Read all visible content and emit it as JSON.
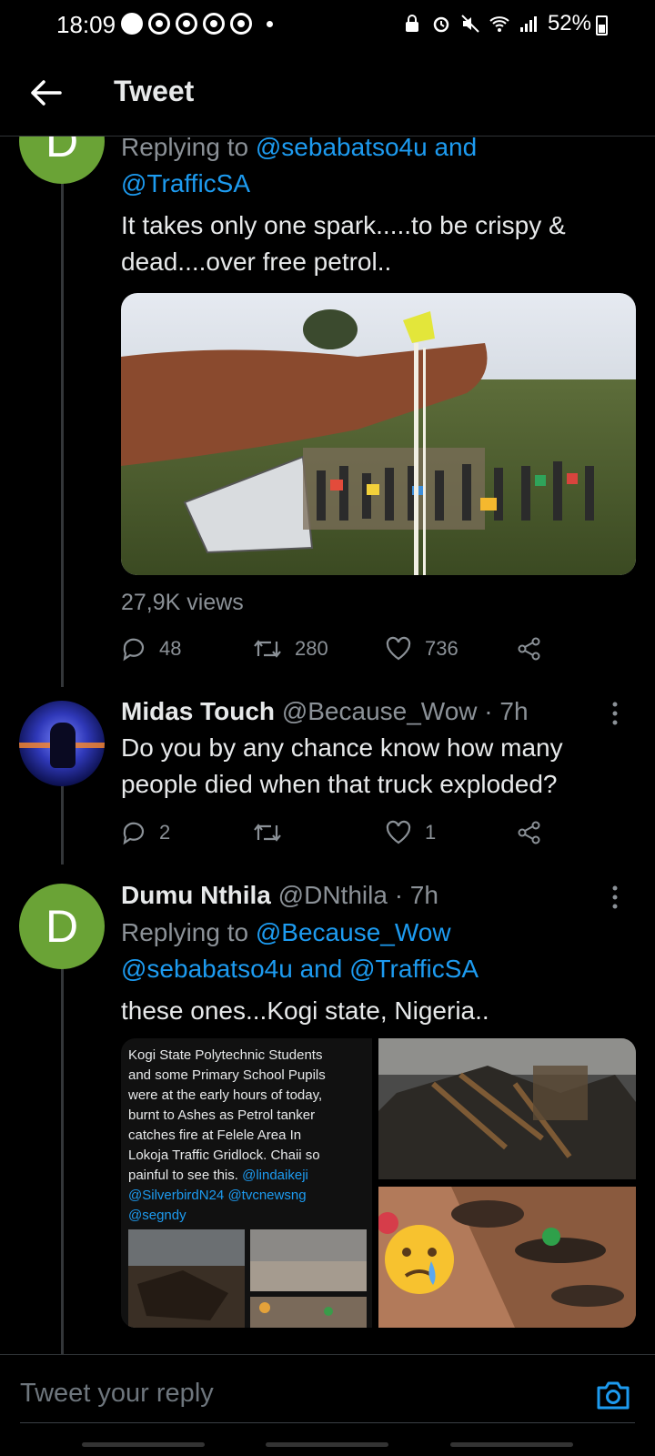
{
  "status": {
    "time": "18:09",
    "battery": "52%"
  },
  "header": {
    "title": "Tweet"
  },
  "tweet1": {
    "avatar_letter": "D",
    "replying_prefix": "Replying to",
    "replying_user1": "@sebabatso4u",
    "replying_and": "and",
    "replying_user2": "@TrafficSA",
    "body_line1": "It takes only one spark.....to be crispy &",
    "body_line2": "dead....over free petrol..",
    "views": "27,9K views",
    "replies": "48",
    "retweets": "280",
    "likes": "736"
  },
  "tweet2": {
    "name": "Midas Touch",
    "handle": "@Because_Wow",
    "time": "· 7h",
    "body_line1": "Do you by any chance know how many",
    "body_line2": "people died when that truck exploded?",
    "replies": "2",
    "retweets": "",
    "likes": "1"
  },
  "tweet3": {
    "avatar_letter": "D",
    "name": "Dumu Nthila",
    "handle": "@DNthila",
    "time": "· 7h",
    "replying_prefix": "Replying to",
    "replying_user1": "@Because_Wow",
    "replying_user2": "@sebabatso4u",
    "replying_and": "and",
    "replying_user3": "@TrafficSA",
    "body": "these ones...Kogi state, Nigeria..",
    "image_caption_lines": [
      "Kogi State Polytechnic Students",
      "and some Primary School Pupils",
      "were at the early hours of today,",
      "burnt to Ashes as Petrol tanker",
      "catches fire at Felele Area In",
      "Lokoja Traffic Gridlock. Chaii so",
      "painful to see this."
    ],
    "image_caption_mentions": {
      "m1": "@lindaikeji",
      "m2": "@SilverbirdN24",
      "m3": "@tvcnewsng",
      "m4": "@segndy"
    }
  },
  "compose": {
    "placeholder": "Tweet your reply"
  },
  "colors": {
    "accent": "#1d9bf0",
    "avatar_green": "#6aa336",
    "background": "#000000"
  }
}
